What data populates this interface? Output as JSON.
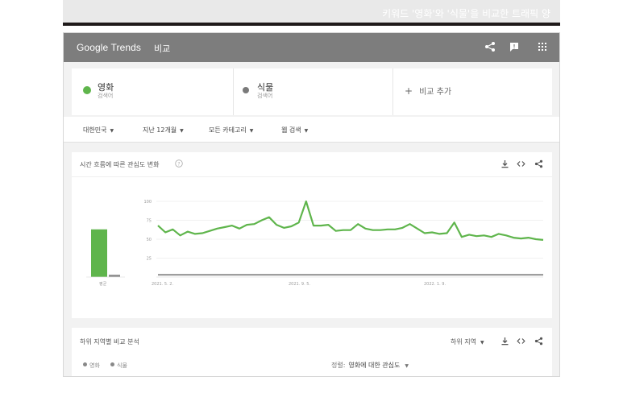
{
  "caption": {
    "text": "키워드 '영화'와 '식물'을 비교한 트래픽 양"
  },
  "header": {
    "logo": "Google Trends",
    "page_label": "비교",
    "icons": [
      "share-icon",
      "feedback-icon",
      "apps-icon"
    ]
  },
  "terms": [
    {
      "name": "영화",
      "sub": "검색어",
      "color": "#5fb54c"
    },
    {
      "name": "식물",
      "sub": "검색어",
      "color": "#7a7a7a"
    }
  ],
  "add_compare": {
    "label": "비교 추가",
    "icon": "plus-icon"
  },
  "filters": [
    {
      "label": "대한민국"
    },
    {
      "label": "지난 12개월"
    },
    {
      "label": "모든 카테고리"
    },
    {
      "label": "웹 검색"
    }
  ],
  "interest_card": {
    "title": "시간 흐름에 따른 관심도 변화",
    "icons": [
      "help-icon",
      "download-icon",
      "embed-icon",
      "share-icon"
    ]
  },
  "chart_data": {
    "type": "line",
    "x_ticks": [
      "2021. 5. 2.",
      "2021. 9. 5.",
      "2022. 1. 9."
    ],
    "y_ticks": [
      100,
      75,
      50,
      25
    ],
    "ylim": [
      0,
      100
    ],
    "grid": true,
    "average_label": "평균",
    "averages": [
      {
        "name": "영화",
        "value": 63
      },
      {
        "name": "식물",
        "value": 3
      }
    ],
    "series": [
      {
        "name": "영화",
        "color": "#5fb54c",
        "values": [
          68,
          59,
          63,
          55,
          60,
          57,
          58,
          61,
          64,
          66,
          68,
          64,
          69,
          70,
          75,
          79,
          69,
          65,
          67,
          72,
          100,
          68,
          68,
          69,
          61,
          62,
          62,
          70,
          64,
          62,
          62,
          63,
          63,
          65,
          70,
          64,
          58,
          59,
          57,
          58,
          72,
          53,
          56,
          54,
          55,
          53,
          57,
          55,
          52,
          51,
          52,
          50,
          49
        ]
      },
      {
        "name": "식물",
        "color": "#8a8a8a",
        "values": [
          3,
          3,
          3,
          3,
          3,
          3,
          3,
          3,
          3,
          3,
          3,
          3,
          3,
          3,
          3,
          3,
          3,
          3,
          3,
          3,
          3,
          3,
          3,
          3,
          3,
          3,
          3,
          3,
          3,
          3,
          3,
          3,
          3,
          3,
          3,
          3,
          3,
          3,
          3,
          3,
          3,
          3,
          3,
          3,
          3,
          3,
          3,
          3,
          3,
          3,
          3,
          3,
          3
        ]
      }
    ]
  },
  "region_card": {
    "title": "하위 지역별 비교 분석",
    "region_select": "하위 지역",
    "legend": [
      "영화",
      "식물"
    ],
    "sort_label": "정렬:",
    "sort_value": "영화에 대한 관심도",
    "icons": [
      "download-icon",
      "embed-icon",
      "share-icon"
    ]
  }
}
